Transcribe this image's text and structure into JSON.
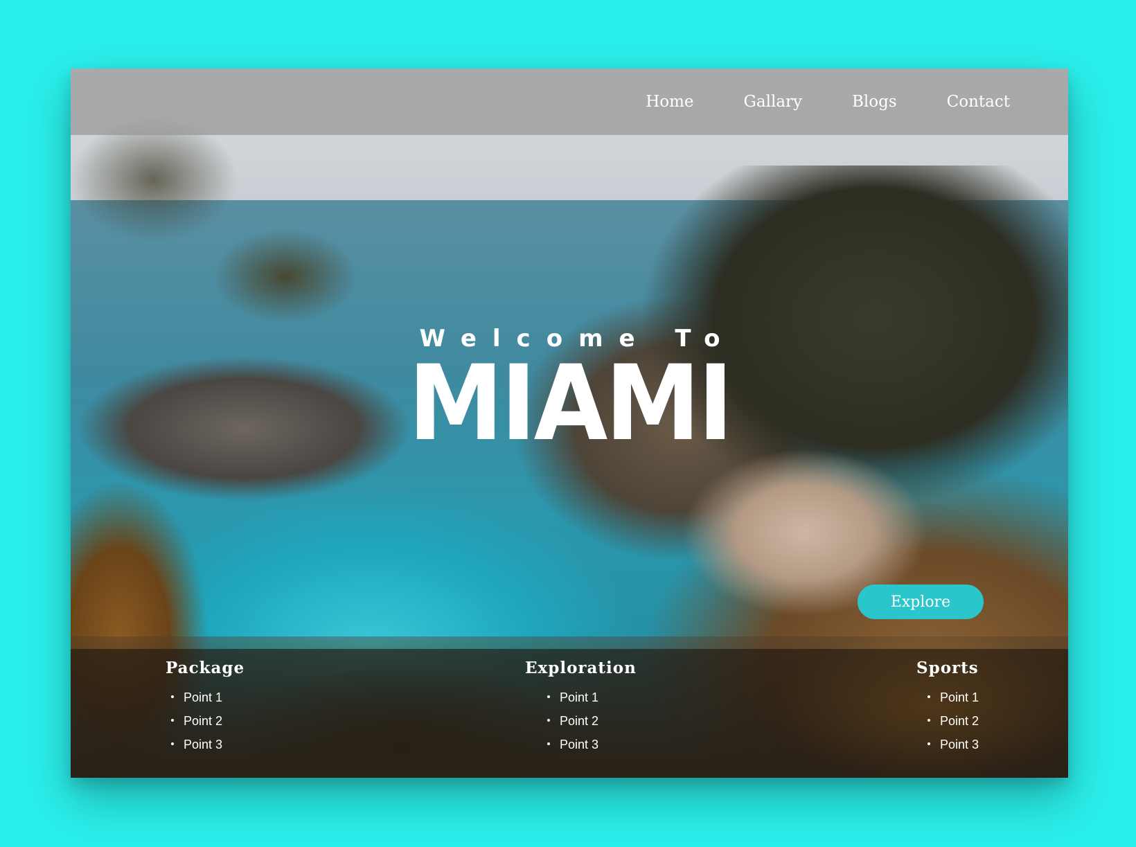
{
  "nav": {
    "items": [
      {
        "label": "Home"
      },
      {
        "label": "Gallary"
      },
      {
        "label": "Blogs"
      },
      {
        "label": "Contact"
      }
    ]
  },
  "hero": {
    "subtitle": "Welcome To",
    "title": "MIAMI"
  },
  "cta": {
    "label": "Explore",
    "color": "#2bc6cb"
  },
  "sections": [
    {
      "title": "Package",
      "items": [
        "Point 1",
        "Point 2",
        "Point 3"
      ]
    },
    {
      "title": "Exploration",
      "items": [
        "Point 1",
        "Point 2",
        "Point 3"
      ]
    },
    {
      "title": "Sports",
      "items": [
        "Point 1",
        "Point 2",
        "Point 3"
      ]
    }
  ],
  "colors": {
    "page_background": "#2aeeea",
    "accent": "#2bc6cb"
  }
}
